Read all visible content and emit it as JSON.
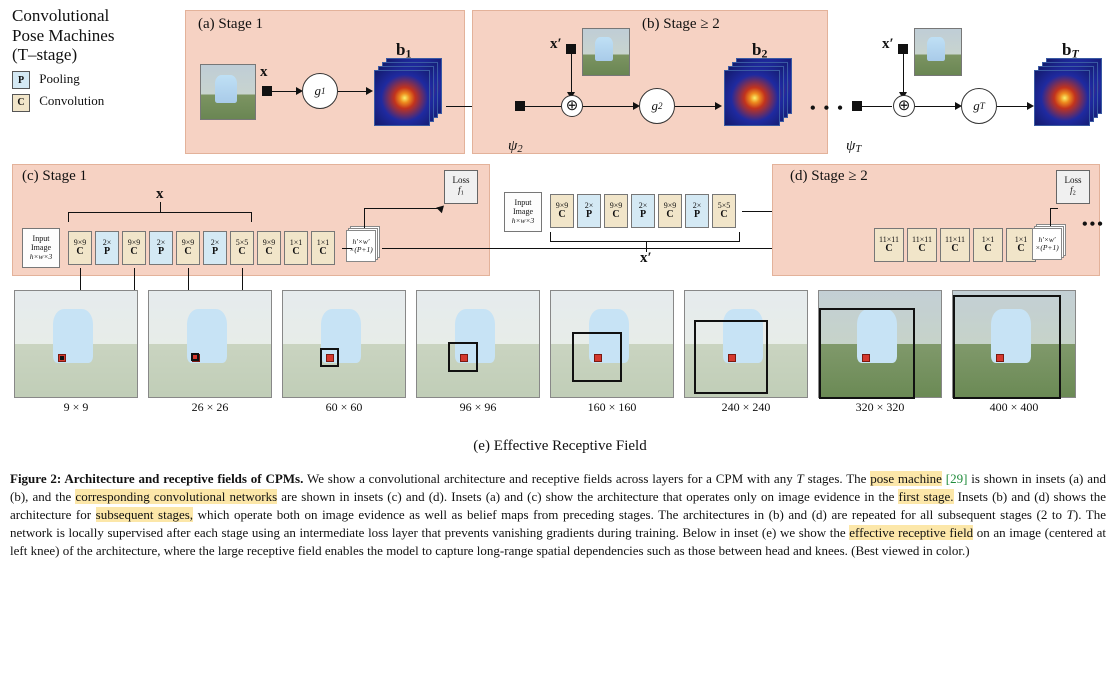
{
  "title_lines": [
    "Convolutional",
    "Pose Machines",
    "(T–stage)"
  ],
  "legend": {
    "p": "Pooling",
    "c": "Convolution",
    "p_sym": "P",
    "c_sym": "C"
  },
  "panels": {
    "a": "(a) Stage 1",
    "b": "(b) Stage ≥ 2",
    "c": "(c) Stage 1",
    "d": "(d) Stage ≥ 2",
    "e": "(e) Effective Receptive Field"
  },
  "symbols": {
    "x": "x",
    "xp": "x′",
    "b1": "b",
    "b2": "b",
    "bT": "b",
    "b1_sub": "1",
    "b2_sub": "2",
    "bT_sub": "T",
    "g1": "g",
    "g1_sub": "1",
    "g2": "g",
    "g2_sub": "2",
    "gT": "g",
    "gT_sub": "T",
    "psi2": "ψ",
    "psi2_sub": "2",
    "psiT": "ψ",
    "psiT_sub": "T",
    "inputImage": "Input\nImage",
    "inputDim": "h×w×3",
    "outDim": "h′×w′\n×(P+1)"
  },
  "loss": {
    "f1": "f",
    "f1_sub": "1",
    "f2": "f",
    "f2_sub": "2",
    "label": "Loss"
  },
  "stage1_layers": [
    {
      "top": "9×9",
      "bot": "C",
      "t": "c"
    },
    {
      "top": "2×",
      "bot": "P",
      "t": "p"
    },
    {
      "top": "9×9",
      "bot": "C",
      "t": "c"
    },
    {
      "top": "2×",
      "bot": "P",
      "t": "p"
    },
    {
      "top": "9×9",
      "bot": "C",
      "t": "c"
    },
    {
      "top": "2×",
      "bot": "P",
      "t": "p"
    },
    {
      "top": "5×5",
      "bot": "C",
      "t": "c"
    },
    {
      "top": "9×9",
      "bot": "C",
      "t": "c"
    },
    {
      "top": "1×1",
      "bot": "C",
      "t": "c"
    },
    {
      "top": "1×1",
      "bot": "C",
      "t": "c"
    }
  ],
  "stage2_front_layers": [
    {
      "top": "9×9",
      "bot": "C",
      "t": "c"
    },
    {
      "top": "2×",
      "bot": "P",
      "t": "p"
    },
    {
      "top": "9×9",
      "bot": "C",
      "t": "c"
    },
    {
      "top": "2×",
      "bot": "P",
      "t": "p"
    },
    {
      "top": "9×9",
      "bot": "C",
      "t": "c"
    },
    {
      "top": "2×",
      "bot": "P",
      "t": "p"
    },
    {
      "top": "5×5",
      "bot": "C",
      "t": "c"
    }
  ],
  "stage2_back_layers": [
    {
      "top": "11×11",
      "bot": "C",
      "t": "c"
    },
    {
      "top": "11×11",
      "bot": "C",
      "t": "c"
    },
    {
      "top": "11×11",
      "bot": "C",
      "t": "c"
    },
    {
      "top": "1×1",
      "bot": "C",
      "t": "c"
    },
    {
      "top": "1×1",
      "bot": "C",
      "t": "c"
    }
  ],
  "rf_labels": [
    "9 × 9",
    "26 × 26",
    "60 × 60",
    "96 × 96",
    "160 × 160",
    "240 × 240",
    "320 × 320",
    "400 × 400"
  ],
  "rf_sizes": [
    9,
    26,
    60,
    96,
    160,
    240,
    320,
    400
  ],
  "caption": {
    "lead": "Figure 2: Architecture and receptive fields of CPMs.",
    "body1": " We show a convolutional architecture and receptive fields across layers for a CPM with any ",
    "T": "T",
    "body2": " stages. The ",
    "hl_posemachine": "pose machine",
    "ref": " [29]",
    "body3": " is shown in insets (a) and (b), and the ",
    "hl_corrnets": "corresponding convolutional networks",
    "body4": " are shown in insets (c) and (d). Insets (a) and (c) show the architecture that operates only on image evidence in the ",
    "hl_first": "first stage.",
    "body5": " Insets (b) and (d) shows the architecture for ",
    "hl_subs": "subsequent stages,",
    "body6": " which operate both on image evidence as well as belief maps from preceding stages. The architectures in (b) and (d) are repeated for all subsequent stages (2 to ",
    "T2": "T",
    "body7": "). The network is locally supervised after each stage using an intermediate loss layer that prevents vanishing gradients during training. Below in inset (e) we show the ",
    "hl_erf": "effective receptive field",
    "body8": " on an image (centered at left knee) of the architecture, where the large receptive field enables the model to capture long-range spatial dependencies such as those between head and knees. (Best viewed in color.)"
  }
}
